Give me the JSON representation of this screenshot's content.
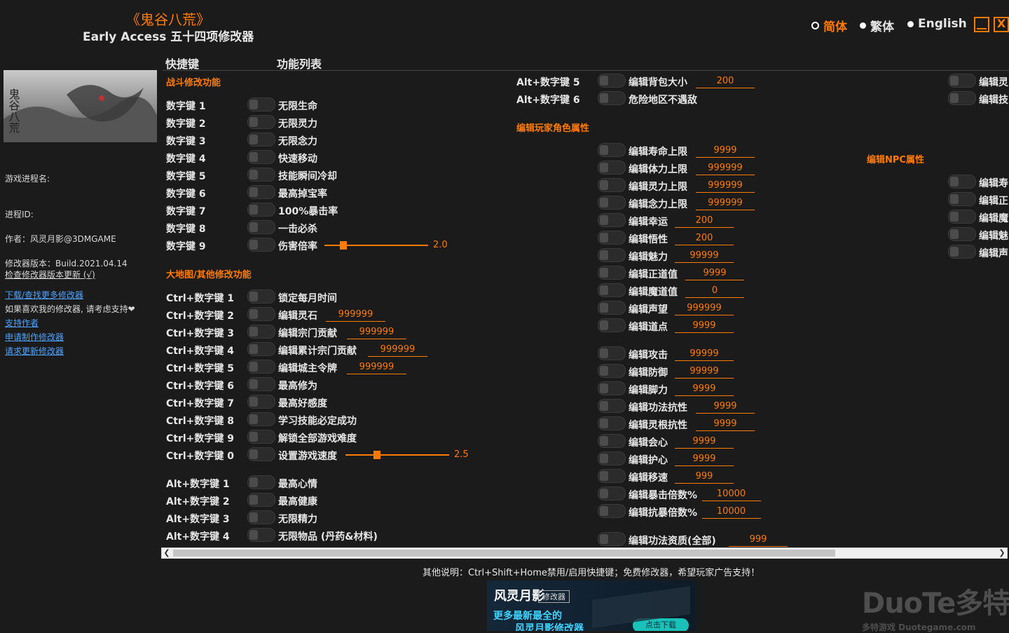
{
  "app": {
    "title_cn": "《鬼谷八荒》",
    "title_en": "Early Access 五十四项修改器"
  },
  "lang": {
    "simplified": "简体",
    "traditional": "繁体",
    "english": "English"
  },
  "window": {
    "min_label": "",
    "close_label": "X"
  },
  "headers": {
    "hotkey": "快捷键",
    "functions": "功能列表"
  },
  "sidebar": {
    "game_process": "游戏进程名:",
    "process_id": "进程ID:",
    "author": "作者：风灵月影@3DMGAME",
    "version": "修改器版本：Build.2021.04.14",
    "check_update": "检查修改器版本更新 (√)",
    "download_more": "下载/查找更多修改器",
    "support_text": "如果喜欢我的修改器, 请考虑支持❤",
    "support_author": "支持作者",
    "request_make": "申请制作修改器",
    "request_update": "请求更新修改器"
  },
  "sections": {
    "combat": "战斗修改功能",
    "map": "大地图/其他修改功能",
    "player": "编辑玩家角色属性",
    "npc": "编辑NPC属性"
  },
  "combat_rows": [
    {
      "key": "数字键 1",
      "name": "无限生命"
    },
    {
      "key": "数字键 2",
      "name": "无限灵力"
    },
    {
      "key": "数字键 3",
      "name": "无限念力"
    },
    {
      "key": "数字键 4",
      "name": "快速移动"
    },
    {
      "key": "数字键 5",
      "name": "技能瞬间冷却"
    },
    {
      "key": "数字键 6",
      "name": "最高掉宝率"
    },
    {
      "key": "数字键 7",
      "name": "100%暴击率"
    },
    {
      "key": "数字键 8",
      "name": "一击必杀"
    },
    {
      "key": "数字键 9",
      "name": "伤害倍率",
      "slider": "2.0",
      "slider_frac": 0.1
    }
  ],
  "map_rows": [
    {
      "key": "Ctrl+数字键 1",
      "name": "锁定每月时间"
    },
    {
      "key": "Ctrl+数字键 2",
      "name": "编辑灵石",
      "value": "999999"
    },
    {
      "key": "Ctrl+数字键 3",
      "name": "编辑宗门贡献",
      "value": "999999"
    },
    {
      "key": "Ctrl+数字键 4",
      "name": "编辑累计宗门贡献",
      "value": "999999"
    },
    {
      "key": "Ctrl+数字键 5",
      "name": "编辑城主令牌",
      "value": "999999"
    },
    {
      "key": "Ctrl+数字键 6",
      "name": "最高修为"
    },
    {
      "key": "Ctrl+数字键 7",
      "name": "最高好感度"
    },
    {
      "key": "Ctrl+数字键 8",
      "name": "学习技能必定成功"
    },
    {
      "key": "Ctrl+数字键 9",
      "name": "解锁全部游戏难度"
    },
    {
      "key": "Ctrl+数字键 0",
      "name": "设置游戏速度",
      "slider": "2.5",
      "slider_frac": 0.25
    }
  ],
  "alt_rows": [
    {
      "key": "Alt+数字键 1",
      "name": "最高心情"
    },
    {
      "key": "Alt+数字键 2",
      "name": "最高健康"
    },
    {
      "key": "Alt+数字键 3",
      "name": "无限精力"
    },
    {
      "key": "Alt+数字键 4",
      "name": "无限物品 (丹药&材料)"
    }
  ],
  "alt_rows2": [
    {
      "key": "Alt+数字键 5",
      "name": "编辑背包大小",
      "value": "200"
    },
    {
      "key": "Alt+数字键 6",
      "name": "危险地区不遇敌"
    }
  ],
  "player_rows": [
    {
      "name": "编辑寿命上限",
      "value": "9999"
    },
    {
      "name": "编辑体力上限",
      "value": "999999"
    },
    {
      "name": "编辑灵力上限",
      "value": "999999"
    },
    {
      "name": "编辑念力上限",
      "value": "999999"
    },
    {
      "name": "编辑幸运",
      "value": "200"
    },
    {
      "name": "编辑悟性",
      "value": "200"
    },
    {
      "name": "编辑魅力",
      "value": "99999"
    },
    {
      "name": "编辑正道值",
      "value": "9999"
    },
    {
      "name": "编辑魔道值",
      "value": "0"
    },
    {
      "name": "编辑声望",
      "value": "999999"
    },
    {
      "name": "编辑道点",
      "value": "9999"
    }
  ],
  "player_rows2": [
    {
      "name": "编辑攻击",
      "value": "99999"
    },
    {
      "name": "编辑防御",
      "value": "99999"
    },
    {
      "name": "编辑脚力",
      "value": "9999"
    },
    {
      "name": "编辑功法抗性",
      "value": "9999"
    },
    {
      "name": "编辑灵根抗性",
      "value": "9999"
    },
    {
      "name": "编辑会心",
      "value": "9999"
    },
    {
      "name": "编辑护心",
      "value": "9999"
    },
    {
      "name": "编辑移速",
      "value": "999"
    },
    {
      "name": "编辑暴击倍数%",
      "value": "10000"
    },
    {
      "name": "编辑抗暴倍数%",
      "value": "10000"
    }
  ],
  "player_last": {
    "name": "编辑功法资质(全部)",
    "value": "999"
  },
  "col4_top": [
    "编辑灵",
    "编辑技"
  ],
  "col4_npc": [
    "编辑寿",
    "编辑正",
    "编辑魔",
    "编辑魅",
    "编辑声"
  ],
  "footer": "其他说明：Ctrl+Shift+Home禁用/启用快捷键；免费修改器，希望玩家广告支持！",
  "banner": {
    "logo": "风灵月影",
    "tag": "修改器",
    "line1": "更多最新最全的",
    "line2": "风灵月影修改器",
    "button": "点击下载"
  },
  "watermark": {
    "brand": "DuoTe多特",
    "sub": "多特游戏 Duotegame.com"
  },
  "colors": {
    "accent": "#ff7a00",
    "bg": "#1b1b1b",
    "link": "#4da3ff"
  }
}
